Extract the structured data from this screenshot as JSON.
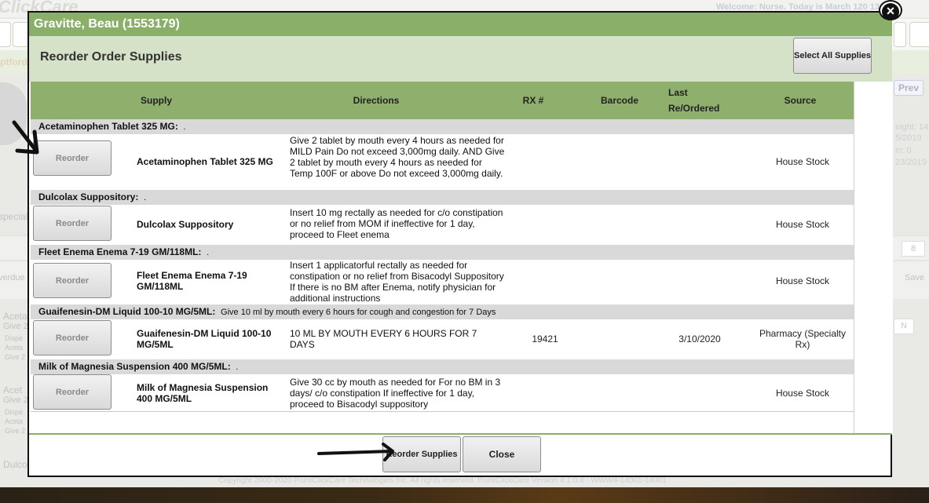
{
  "background": {
    "logo": "ClickCare",
    "welcome": "Welcome: Nurse.    Today is March 1",
    "welcome_tail": "20  13",
    "band_text": "ptford",
    "prev": "Prev",
    "right_texts": [
      "eight: 14",
      "5/2019",
      "in: 0",
      "23/2019"
    ],
    "left_texts": [
      "special",
      "verdue",
      "Aceta",
      "Give 2",
      "Dispe",
      "Aceta",
      "Give 2",
      "Acet",
      "Give 2",
      "Dispe",
      "Aceta",
      "Give 2",
      "Dulco"
    ],
    "page_num": "8",
    "save": "Save",
    "n": "N",
    "footer": "Copyright 2000-2020 PointClickCare Technologies Inc. All rights reserved.  PointClickCare Version 4.1.0.4 - WWW4-14001-14001"
  },
  "modal": {
    "title": "Gravitte, Beau (1553179)",
    "subtitle": "Reorder Order Supplies",
    "select_all_label": "Select All Supplies",
    "close_icon": "close-icon",
    "columns": [
      "Supply",
      "Directions",
      "RX #",
      "Barcode",
      "Last Re/Ordered",
      "Source"
    ],
    "groups": [
      {
        "header": "Acetaminophen Tablet 325 MG:",
        "detail": ".",
        "button": "Reorder",
        "supply": "Acetaminophen Tablet 325 MG",
        "directions": "Give 2 tablet by mouth every 4 hours as needed for MILD Pain Do not exceed 3,000mg daily. AND Give 2 tablet by mouth every 4 hours as needed for Temp 100F or above Do not exceed 3,000mg daily.",
        "rx": "",
        "barcode": "",
        "last": "",
        "source": "House Stock"
      },
      {
        "header": "Dulcolax Suppository:",
        "detail": ".",
        "button": "Reorder",
        "supply": "Dulcolax Suppository",
        "directions": "Insert 10 mg rectally as needed for c/o constipation or no relief from MOM if ineffective for 1 day, proceed to Fleet enema",
        "rx": "",
        "barcode": "",
        "last": "",
        "source": "House Stock"
      },
      {
        "header": "Fleet Enema Enema 7-19 GM/118ML:",
        "detail": ".",
        "button": "Reorder",
        "supply": "Fleet Enema Enema 7-19 GM/118ML",
        "directions": "Insert 1 applicatorful rectally as needed for constipation or no relief from Bisacodyl Suppository If there is no BM after Enema, notify physician for additional instructions",
        "rx": "",
        "barcode": "",
        "last": "",
        "source": "House Stock"
      },
      {
        "header": "Guaifenesin-DM Liquid 100-10 MG/5ML:",
        "detail": "Give 10 ml by mouth every 6 hours for cough and congestion for 7 Days",
        "button": "Reorder",
        "supply": "Guaifenesin-DM Liquid 100-10 MG/5ML",
        "directions": "10 ML BY MOUTH EVERY 6 HOURS FOR 7 DAYS",
        "rx": "19421",
        "barcode": "",
        "last": "3/10/2020",
        "source": "Pharmacy  (Specialty Rx)"
      },
      {
        "header": "Milk of Magnesia Suspension 400 MG/5ML:",
        "detail": ".",
        "button": "Reorder",
        "supply": "Milk of Magnesia Suspension 400 MG/5ML",
        "directions": "Give 30 cc by mouth as needed for For no BM in 3 days/ c/o constipation If ineffective for 1 day, proceed to Bisacodyl suppository",
        "rx": "",
        "barcode": "",
        "last": "",
        "source": "House Stock"
      }
    ],
    "reorder_supplies_label": "Reorder Supplies",
    "close_label": "Close"
  },
  "colors": {
    "title_bar": "#8aaf68",
    "sub_header": "#d6e2c8",
    "table_header": "#8fb06c",
    "group_row": "#d9d9d9"
  }
}
